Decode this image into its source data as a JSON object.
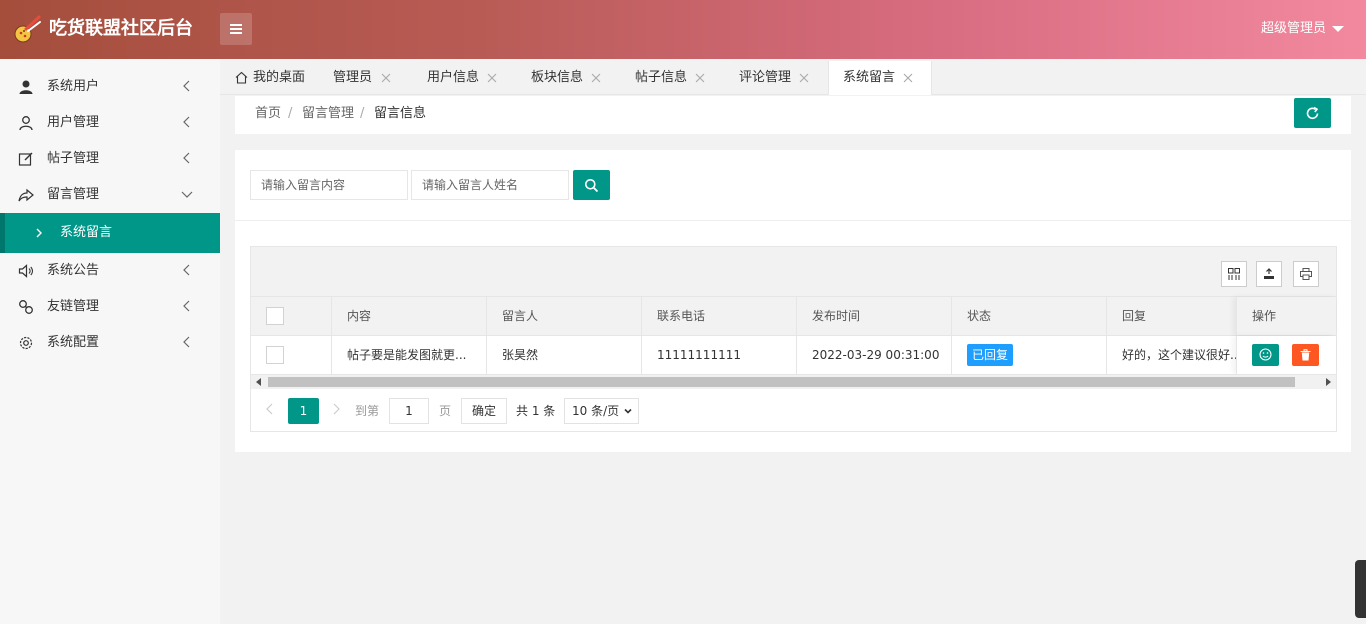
{
  "app": {
    "title": "吃货联盟社区后台"
  },
  "header": {
    "user": "超级管理员"
  },
  "sidebar": {
    "items": [
      {
        "label": "系统用户"
      },
      {
        "label": "用户管理"
      },
      {
        "label": "帖子管理"
      },
      {
        "label": "留言管理"
      },
      {
        "label": "系统公告"
      },
      {
        "label": "友链管理"
      },
      {
        "label": "系统配置"
      }
    ],
    "sub_active": "系统留言"
  },
  "tabs": [
    {
      "label": "我的桌面"
    },
    {
      "label": "管理员"
    },
    {
      "label": "用户信息"
    },
    {
      "label": "板块信息"
    },
    {
      "label": "帖子信息"
    },
    {
      "label": "评论管理"
    },
    {
      "label": "系统留言"
    }
  ],
  "breadcrumb": [
    "首页",
    "留言管理",
    "留言信息"
  ],
  "search": {
    "content_placeholder": "请输入留言内容",
    "name_placeholder": "请输入留言人姓名"
  },
  "table": {
    "columns": [
      "内容",
      "留言人",
      "联系电话",
      "发布时间",
      "状态",
      "回复",
      "操作"
    ],
    "rows": [
      {
        "content": "帖子要是能发图就更...",
        "author": "张昊然",
        "phone": "11111111111",
        "time": "2022-03-29 00:31:00",
        "status": "已回复",
        "reply": "好的，这个建议很好..."
      }
    ]
  },
  "pagination": {
    "current": "1",
    "goto_label": "到第",
    "page_input": "1",
    "page_unit": "页",
    "confirm": "确定",
    "total": "共 1 条",
    "page_size": "10 条/页"
  },
  "colors": {
    "primary": "#009688",
    "info": "#1e9fff",
    "danger": "#ff5722",
    "header_start": "#a54e3c",
    "header_end": "#f2899f"
  }
}
